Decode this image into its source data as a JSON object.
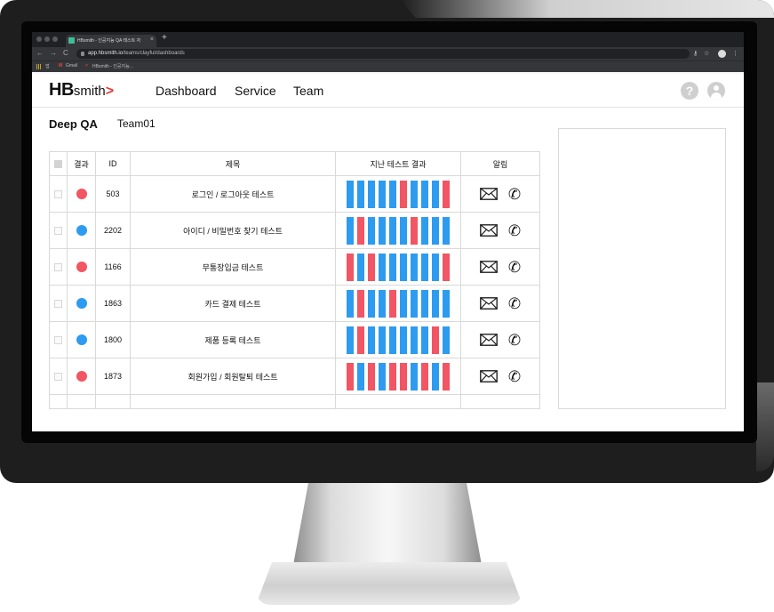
{
  "browser": {
    "tab_title": "HBsmith - 인공지능 QA 테스트 자",
    "tab_close": "×",
    "new_tab": "+",
    "back_icon": "←",
    "forward_icon": "→",
    "reload_icon": "C",
    "url_host": "app.hbsmith.io",
    "url_path": "/teams/clayful/dashboards",
    "bookmarks": {
      "apps_label": "앱",
      "gmail": "Gmail",
      "hbsmith": "HBsmith - 인공지능..."
    }
  },
  "app": {
    "logo": {
      "hb": "HB",
      "smith": "smith",
      "arrow": ">"
    },
    "nav": [
      "Dashboard",
      "Service",
      "Team"
    ],
    "help_icon": "?",
    "project": "Deep QA",
    "team": "Team01"
  },
  "table": {
    "headers": {
      "result": "결과",
      "id": "ID",
      "title": "제목",
      "history": "지난 테스트 결과",
      "alerts": "알림"
    },
    "rows": [
      {
        "result_color": "#f25563",
        "id": "503",
        "title": "로그인 / 로그아웃 테스트",
        "history": [
          "pass",
          "pass",
          "pass",
          "pass",
          "pass",
          "fail",
          "pass",
          "pass",
          "pass",
          "fail"
        ]
      },
      {
        "result_color": "#2d9bf0",
        "id": "2202",
        "title": "아이디 / 비밀번호 찾기 테스트",
        "history": [
          "pass",
          "fail",
          "pass",
          "pass",
          "pass",
          "pass",
          "fail",
          "pass",
          "pass",
          "pass"
        ]
      },
      {
        "result_color": "#f25563",
        "id": "1166",
        "title": "무통장입금 테스트",
        "history": [
          "fail",
          "pass",
          "fail",
          "pass",
          "pass",
          "pass",
          "pass",
          "pass",
          "pass",
          "fail"
        ]
      },
      {
        "result_color": "#2d9bf0",
        "id": "1863",
        "title": "카드 결제 테스트",
        "history": [
          "pass",
          "fail",
          "pass",
          "pass",
          "fail",
          "pass",
          "pass",
          "pass",
          "pass",
          "pass"
        ]
      },
      {
        "result_color": "#2d9bf0",
        "id": "1800",
        "title": "제품 등록 테스트",
        "history": [
          "pass",
          "fail",
          "pass",
          "pass",
          "pass",
          "pass",
          "pass",
          "pass",
          "fail",
          "pass"
        ]
      },
      {
        "result_color": "#f25563",
        "id": "1873",
        "title": "회원가입 / 회원탈퇴 테스트",
        "history": [
          "fail",
          "pass",
          "fail",
          "pass",
          "fail",
          "fail",
          "pass",
          "fail",
          "pass",
          "fail"
        ]
      }
    ]
  },
  "colors": {
    "pass": "#2d9bf0",
    "fail": "#f25563"
  },
  "icons": {
    "mail": "envelope-icon",
    "phone": "phone-icon",
    "phone_glyph": "✆"
  }
}
